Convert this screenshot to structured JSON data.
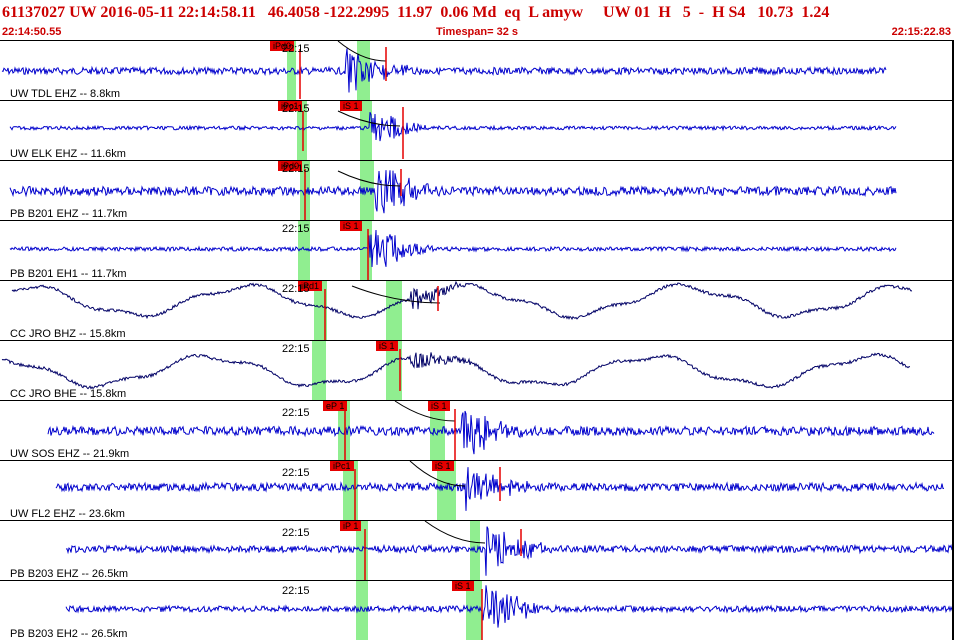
{
  "header": {
    "title": "61137027 UW 2016-05-11 22:14:58.11   46.4058 -122.2995  11.97  0.06 Md  eq  L amyw     UW 01  H   5  -  H S4   10.73  1.24",
    "start_time": "22:14:50.55",
    "timespan": "Timespan=  32 s",
    "end_time": "22:15:22.83"
  },
  "colors": {
    "trace_blue": "#0000cc",
    "trace_broadband": "#000066",
    "pick_red": "#e60000",
    "window_green": "#90ee90",
    "header_red": "#cc0000"
  },
  "channels": [
    {
      "label": "UW TDL EHZ -- 8.8km",
      "tick": "22:15",
      "p_pick": "iPd0",
      "s_pick": ""
    },
    {
      "label": "UW ELK EHZ -- 11.6km",
      "tick": "22:15",
      "p_pick": "iPc1",
      "s_pick": "iS 1"
    },
    {
      "label": "PB B201 EHZ -- 11.7km",
      "tick": "22:15",
      "p_pick": "iPd0",
      "s_pick": ""
    },
    {
      "label": "PB B201 EH1 -- 11.7km",
      "tick": "22:15",
      "p_pick": "",
      "s_pick": "iS 1"
    },
    {
      "label": "CC JRO BHZ -- 15.8km",
      "tick": "22:15",
      "p_pick": "iPd1",
      "s_pick": ""
    },
    {
      "label": "CC JRO BHE -- 15.8km",
      "tick": "22:15",
      "p_pick": "",
      "s_pick": "iS 1"
    },
    {
      "label": "UW SOS EHZ -- 21.9km",
      "tick": "22:15",
      "p_pick": "eP 1",
      "s_pick": "iS 1"
    },
    {
      "label": "UW FL2 EHZ -- 23.6km",
      "tick": "22:15",
      "p_pick": "iPc1",
      "s_pick": "iS 1"
    },
    {
      "label": "PB B203 EHZ -- 26.5km",
      "tick": "22:15",
      "p_pick": "iP 1",
      "s_pick": ""
    },
    {
      "label": "PB B203 EH2 -- 26.5km",
      "tick": "22:15",
      "p_pick": "",
      "s_pick": "iS 1"
    }
  ]
}
